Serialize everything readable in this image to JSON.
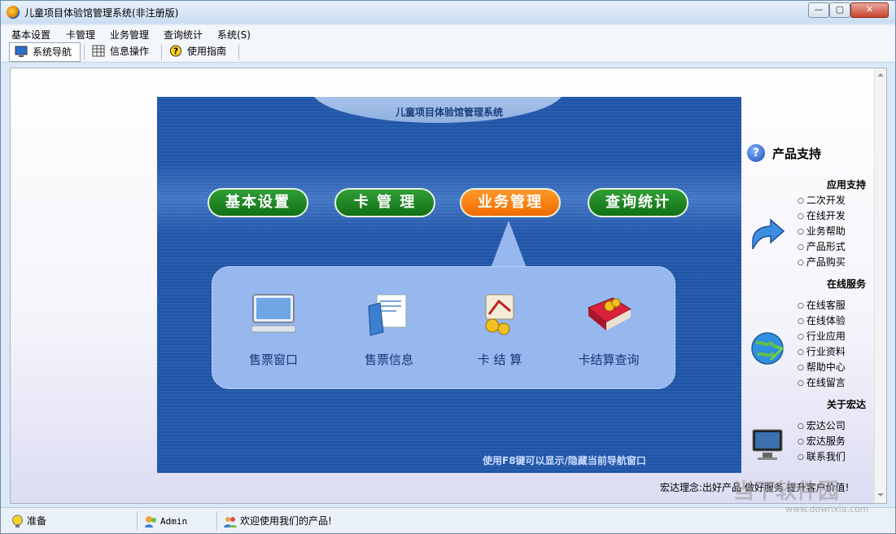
{
  "window": {
    "title": "儿童项目体验馆管理系统(非注册版)"
  },
  "menubar": {
    "items": [
      "基本设置",
      "卡管理",
      "业务管理",
      "查询统计",
      "系统(S)"
    ]
  },
  "toolbar": {
    "items": [
      "系统导航",
      "信息操作",
      "使用指南"
    ]
  },
  "nav": {
    "title": "儿童项目体验馆管理系统",
    "modules": [
      "基本设置",
      "卡 管 理",
      "业务管理",
      "查询统计"
    ],
    "active_module": "业务管理",
    "sub_items": [
      "售票窗口",
      "售票信息",
      "卡 结 算",
      "卡结算查询"
    ],
    "hint": "使用F8键可以显示/隐藏当前导航窗口"
  },
  "support": {
    "title": "产品支持",
    "sections": [
      {
        "heading": "应用支持",
        "icon": "arrow-icon",
        "items": [
          "二次开发",
          "在线开发",
          "业务帮助",
          "产品形式",
          "产品购买"
        ]
      },
      {
        "heading": "在线服务",
        "icon": "globe-icon",
        "items": [
          "在线客服",
          "在线体验",
          "行业应用",
          "行业资料",
          "帮助中心",
          "在线留言"
        ]
      },
      {
        "heading": "关于宏达",
        "icon": "monitor-icon",
        "items": [
          "宏达公司",
          "宏达服务",
          "联系我们"
        ]
      }
    ],
    "slogan": "宏达理念:出好产品 做好服务 提升客户价值!"
  },
  "statusbar": {
    "status": "准备",
    "user": "Admin",
    "message": "欢迎使用我们的产品!"
  },
  "watermark": {
    "main": "当下软件园",
    "sub": "www.downxia.com"
  },
  "colors": {
    "nav_bg": "#1b4fa0",
    "pill_green": "#1f8a24",
    "pill_orange": "#f47d0e",
    "sub_panel": "#97b8ee"
  }
}
